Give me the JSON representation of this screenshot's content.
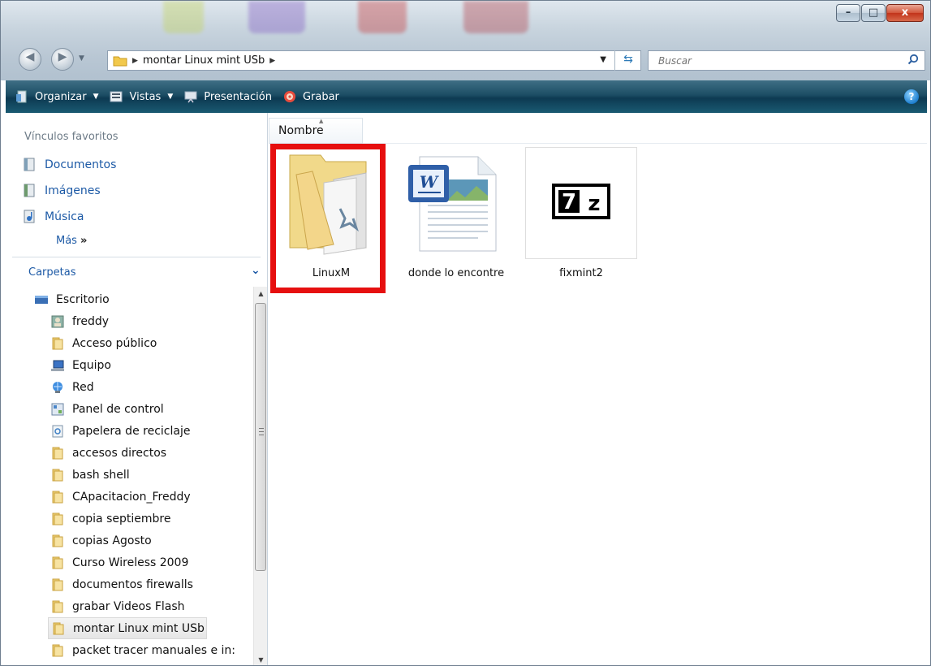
{
  "window": {
    "controls": {
      "minimize": "–",
      "maximize": "□",
      "close": "x"
    }
  },
  "address": {
    "path": "montar Linux mint USb",
    "search_placeholder": "Buscar"
  },
  "toolbar": {
    "items": [
      "Organizar",
      "Vistas",
      "Presentación",
      "Grabar"
    ],
    "help": "?"
  },
  "sidebar": {
    "favorites_header": "Vínculos favoritos",
    "favorites": [
      "Documentos",
      "Imágenes",
      "Música"
    ],
    "more": "Más",
    "more_chevron": "»",
    "folders_header": "Carpetas",
    "folders_chevron": "⌄",
    "tree": [
      "Escritorio",
      "freddy",
      "Acceso público",
      "Equipo",
      "Red",
      "Panel de control",
      "Papelera de reciclaje",
      "accesos directos",
      "bash shell",
      "CApacitacion_Freddy",
      "copia septiembre",
      "copias Agosto",
      "Curso Wireless 2009",
      "documentos firewalls",
      "grabar Videos Flash",
      "montar Linux mint USb",
      "packet tracer manuales e in:"
    ],
    "selected_index": 15
  },
  "content": {
    "column_header": "Nombre",
    "files": [
      {
        "name": "LinuxM",
        "type": "folder-icon",
        "highlighted": true
      },
      {
        "name": "donde lo encontre",
        "type": "word-document-icon"
      },
      {
        "name": "fixmint2",
        "type": "7z-archive-icon"
      }
    ],
    "highlight_color": "#e60f0f"
  },
  "colors": {
    "link_blue": "#1d5aa6",
    "command_bar": "#1c4d64"
  }
}
